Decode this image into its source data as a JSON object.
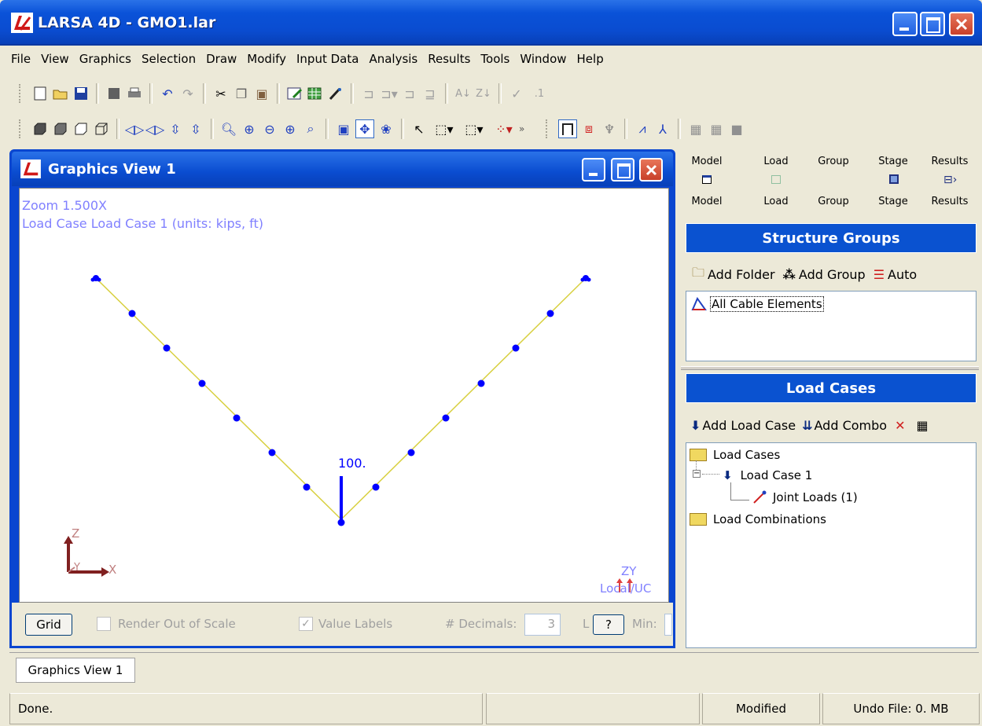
{
  "window": {
    "title": "LARSA 4D - GMO1.lar"
  },
  "menu": [
    "File",
    "View",
    "Graphics",
    "Selection",
    "Draw",
    "Modify",
    "Input Data",
    "Analysis",
    "Results",
    "Tools",
    "Window",
    "Help"
  ],
  "toolbar_misc": {
    "num_label": ".1"
  },
  "graphics_view": {
    "title": "Graphics View 1",
    "zoom_text": "Zoom  1.500X",
    "load_case_text": "Load Case Load Case 1 (units: kips, ft)",
    "load_value_label": "100.",
    "axis_z": "Z",
    "axis_y": "Y",
    "axis_x": "X",
    "local_axis_label": "ZY",
    "local_uc_label": "Local/UC",
    "bottom": {
      "grid_button": "Grid",
      "render_out_of_scale": "Render Out of Scale",
      "value_labels": "Value Labels",
      "decimals_label": "# Decimals:",
      "decimals_value": "3",
      "partial_label": "L",
      "help_button": "?",
      "min_label": "Min:"
    }
  },
  "explorer_tabs": {
    "top": [
      "Model",
      "Load",
      "Group",
      "Stage",
      "Results"
    ],
    "bottom": [
      "Model",
      "Load",
      "Group",
      "Stage",
      "Results"
    ]
  },
  "structure_groups": {
    "header": "Structure Groups",
    "add_folder": "Add Folder",
    "add_group": "Add Group",
    "auto": "Auto",
    "items": [
      "All Cable Elements"
    ]
  },
  "load_cases": {
    "header": "Load Cases",
    "add_load_case": "Add Load Case",
    "add_combo": "Add Combo",
    "tree": {
      "folder": "Load Cases",
      "case": "Load Case 1",
      "joint_loads": "Joint Loads (1)",
      "combos": "Load Combinations"
    }
  },
  "doc_tab": "Graphics View 1",
  "statusbar": {
    "message": "Done.",
    "modified": "Modified",
    "undo": "Undo File: 0. MB"
  },
  "colors": {
    "title_blue": "#0a52d8",
    "node_blue": "#0000ff",
    "cable": "#d8d040",
    "panel_head": "#0a52d0"
  }
}
